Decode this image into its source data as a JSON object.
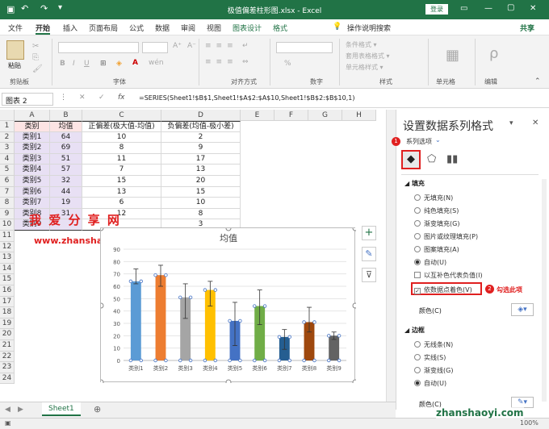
{
  "window": {
    "title": "极值偏差柱形图.xlsx  -  Excel",
    "login": "登录",
    "win_min": "—",
    "win_restore": "▢",
    "win_close": "✕"
  },
  "tabs": [
    "文件",
    "开始",
    "插入",
    "页面布局",
    "公式",
    "数据",
    "审阅",
    "视图",
    "图表设计",
    "格式"
  ],
  "tellme": "操作说明搜索",
  "share": "共享",
  "ribbon": {
    "paste": "粘贴",
    "groups": [
      "剪贴板",
      "字体",
      "对齐方式",
      "数字",
      "样式",
      "单元格",
      "编辑"
    ],
    "cond_format": "条件格式 ▾",
    "table_format": "套用表格格式 ▾",
    "cell_styles": "单元格样式 ▾",
    "percent": "%",
    "cells_icon": "▦",
    "edit_icon": "ρ"
  },
  "formula": {
    "namebox": "图表 2",
    "fx": "fx",
    "cancel": "✕",
    "confirm": "✓",
    "text": "=SERIES(Sheet1!$B$1,Sheet1!$A$2:$A$10,Sheet1!$B$2:$B$10,1)"
  },
  "sheet": {
    "columns": [
      "A",
      "B",
      "C",
      "D",
      "E",
      "F",
      "G",
      "H"
    ],
    "rows": [
      "1",
      "2",
      "3",
      "4",
      "5",
      "6",
      "7",
      "8",
      "9",
      "10",
      "11",
      "12",
      "13",
      "14",
      "15",
      "16",
      "17",
      "18",
      "19",
      "20",
      "21",
      "22",
      "23",
      "24"
    ],
    "header": [
      "类别",
      "均值",
      "正偏差(极大值-均值)",
      "负偏差(均值-极小差)"
    ],
    "data": [
      [
        "类别1",
        "64",
        "10",
        "2"
      ],
      [
        "类别2",
        "69",
        "8",
        "9"
      ],
      [
        "类别3",
        "51",
        "11",
        "17"
      ],
      [
        "类别4",
        "57",
        "7",
        "13"
      ],
      [
        "类别5",
        "32",
        "15",
        "20"
      ],
      [
        "类别6",
        "44",
        "13",
        "15"
      ],
      [
        "类别7",
        "19",
        "6",
        "10"
      ],
      [
        "类别8",
        "31",
        "12",
        "8"
      ],
      [
        "类别9",
        "",
        "",
        "3"
      ]
    ],
    "tab": "Sheet1"
  },
  "watermark": {
    "cn": "我 爱 分 享 网",
    "url": "www.zhanshaoyi.com"
  },
  "chart_data": {
    "type": "bar",
    "title": "均值",
    "categories": [
      "类别1",
      "类别2",
      "类别3",
      "类别4",
      "类别5",
      "类别6",
      "类别7",
      "类别8",
      "类别9"
    ],
    "series": [
      {
        "values": [
          64,
          69,
          51,
          57,
          32,
          44,
          19,
          31,
          20
        ]
      }
    ],
    "error_plus": [
      10,
      8,
      11,
      7,
      15,
      13,
      6,
      12,
      3
    ],
    "error_minus": [
      2,
      9,
      17,
      13,
      20,
      15,
      10,
      8,
      3
    ],
    "colors": [
      "#5b9bd5",
      "#ed7d31",
      "#a5a5a5",
      "#ffc000",
      "#4472c4",
      "#70ad47",
      "#255e91",
      "#9e480e",
      "#636363"
    ],
    "ylim": [
      0,
      90
    ],
    "yticks": [
      0,
      10,
      20,
      30,
      40,
      50,
      60,
      70,
      80,
      90
    ],
    "grid": true
  },
  "panel": {
    "title": "设置数据系列格式",
    "series_options": "系列选项",
    "fill_section": "填充",
    "fill_options": [
      "无填充(N)",
      "纯色填充(S)",
      "渐变填充(G)",
      "图片或纹理填充(P)",
      "图案填充(A)",
      "自动(U)"
    ],
    "invert": "以互补色代表负值(I)",
    "vary_colors": "依数据点着色(V)",
    "annotation": "勾选此项",
    "badge1": "1",
    "badge2": "2",
    "color_label": "颜色(C)",
    "border_section": "边框",
    "border_options": [
      "无线条(N)",
      "实线(S)",
      "渐变线(G)",
      "自动(U)"
    ],
    "color_label2": "颜色(C)",
    "close": "✕"
  },
  "status": {
    "zoom": "100%",
    "site": "zhanshaoyi.com"
  }
}
